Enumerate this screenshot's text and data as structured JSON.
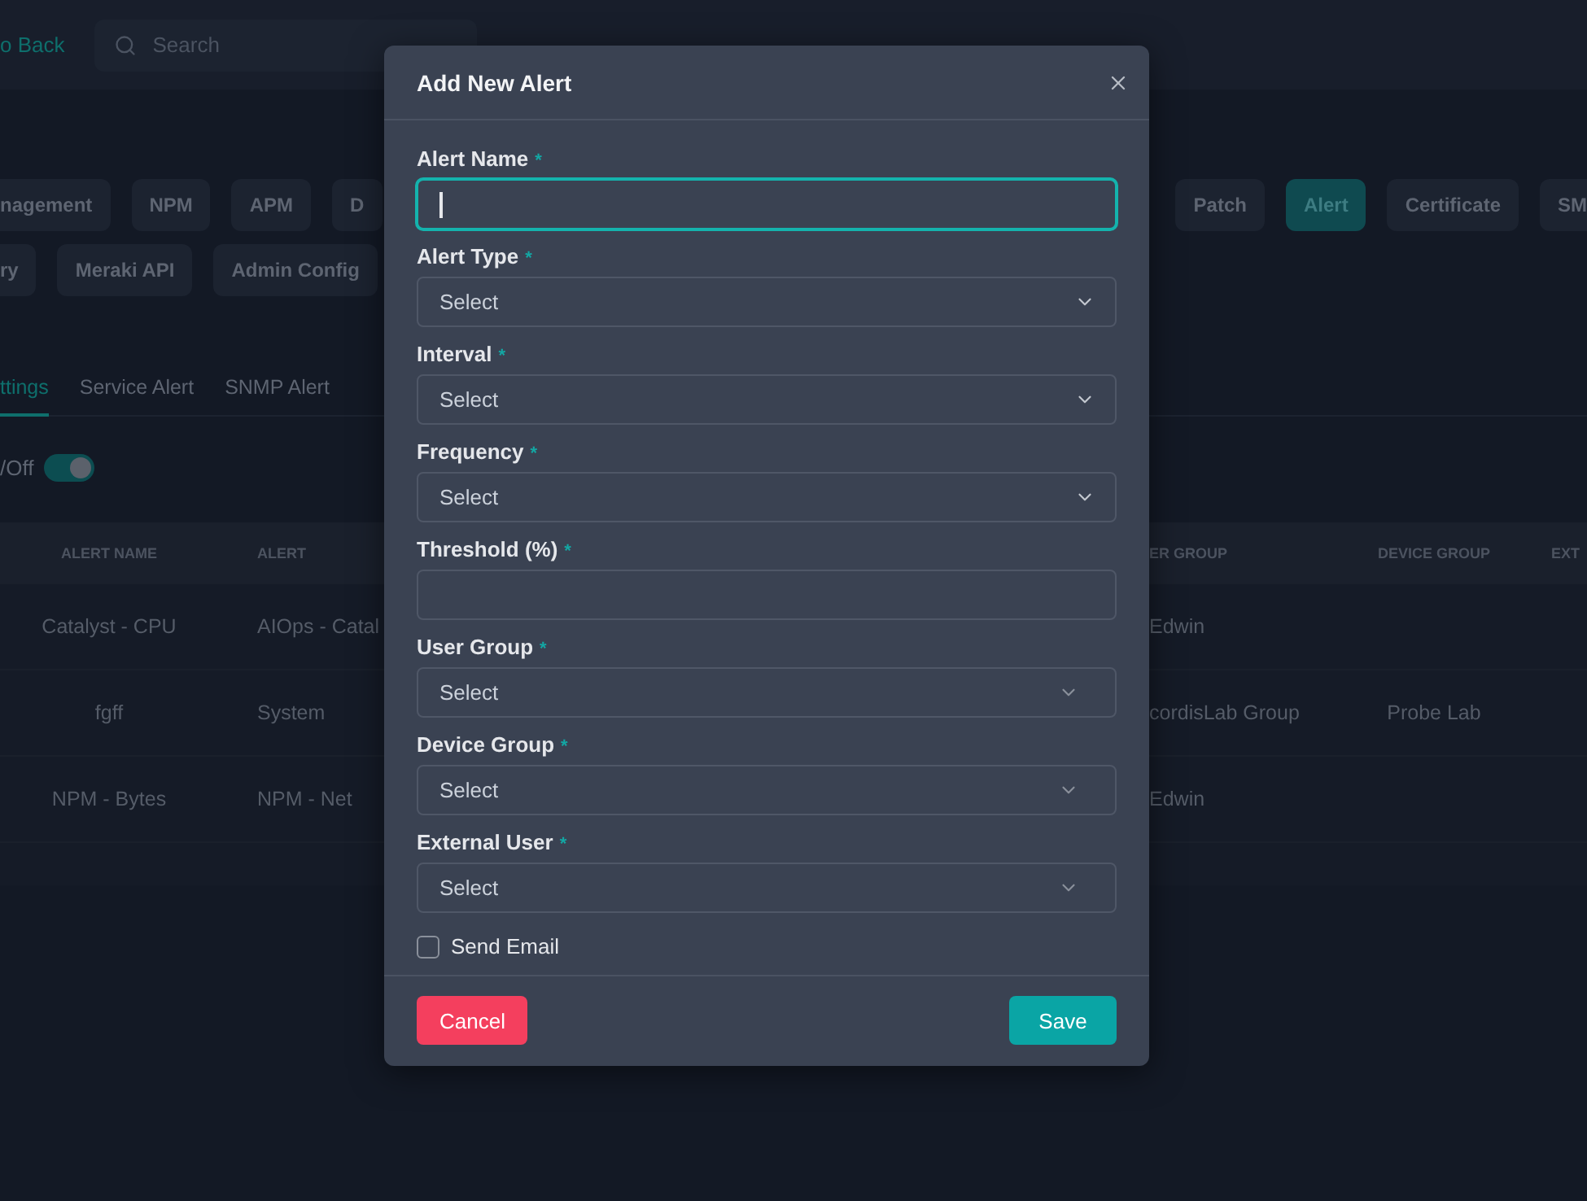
{
  "top_bar": {
    "back_link": "o Back",
    "search": {
      "placeholder": "Search"
    }
  },
  "modules": [
    {
      "left": [
        {
          "label": "nagement",
          "selected": false
        },
        {
          "label": "NPM",
          "selected": false
        },
        {
          "label": "APM",
          "selected": false
        },
        {
          "label": "D",
          "selected": false
        }
      ],
      "right": [
        {
          "label": "Patch",
          "selected": false
        },
        {
          "label": "Alert",
          "selected": true
        },
        {
          "label": "Certificate",
          "selected": false
        },
        {
          "label": "SM",
          "selected": false
        }
      ]
    },
    {
      "left": [
        {
          "label": "ry",
          "selected": false
        },
        {
          "label": "Meraki API",
          "selected": false
        },
        {
          "label": "Admin Config",
          "selected": false
        }
      ]
    }
  ],
  "tabs": [
    {
      "label": "ttings",
      "selected": true
    },
    {
      "label": "Service Alert",
      "selected": false
    },
    {
      "label": "SNMP Alert",
      "selected": false
    }
  ],
  "toggle": {
    "label": "/Off",
    "on": true
  },
  "table": {
    "left_columns": [
      "ALERT NAME",
      "ALERT"
    ],
    "right_columns": [
      "ER GROUP",
      "DEVICE GROUP",
      "EXT"
    ],
    "rows": [
      {
        "left": [
          "Catalyst - CPU",
          "AIOps - Catal"
        ],
        "right": [
          "Edwin"
        ]
      },
      {
        "left": [
          "fgff",
          "System"
        ],
        "right": [
          "cordisLab Group",
          "Probe Lab"
        ]
      },
      {
        "left": [
          "NPM - Bytes",
          "NPM - Net"
        ],
        "right": [
          "Edwin"
        ]
      }
    ]
  },
  "dialog": {
    "title": "Add New Alert",
    "fields": [
      {
        "label": "Alert Name",
        "kind": "input",
        "required_mark": "*",
        "focused": true
      },
      {
        "label": "Alert Type",
        "kind": "select",
        "required_mark": "*",
        "placeholder": "Select",
        "focused": false
      },
      {
        "label": "Interval",
        "kind": "select",
        "required_mark": "*",
        "placeholder": "Select",
        "focused": false
      },
      {
        "label": "Frequency",
        "kind": "select",
        "required_mark": "*",
        "placeholder": "Select",
        "focused": false
      },
      {
        "label": "Threshold (%)",
        "kind": "input",
        "required_mark": "*",
        "focused": false
      },
      {
        "label": "User Group",
        "kind": "multiselect",
        "required_mark": "*",
        "placeholder": "Select",
        "focused": false
      },
      {
        "label": "Device Group",
        "kind": "multiselect",
        "required_mark": "*",
        "placeholder": "Select",
        "focused": false
      },
      {
        "label": "External User",
        "kind": "multiselect",
        "required_mark": "*",
        "placeholder": "Select",
        "focused": false
      }
    ],
    "checkbox": {
      "label": "Send Email",
      "checked": false
    },
    "buttons": [
      {
        "label": "Cancel",
        "kind": "danger"
      },
      {
        "label": "Save",
        "kind": "primary"
      }
    ]
  }
}
